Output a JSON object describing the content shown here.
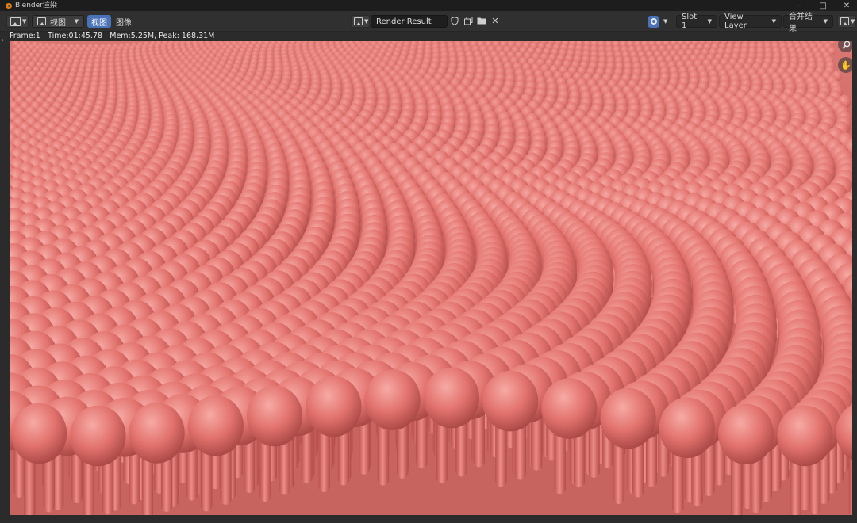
{
  "window": {
    "title": "Blender渲染",
    "minimize": "–",
    "maximize": "□",
    "close": "✕"
  },
  "header": {
    "menu_view": "视图",
    "tab_view": "视图",
    "menu_image": "图像",
    "image_name": "Render Result",
    "slot": "Slot 1",
    "view_layer": "View Layer",
    "pass": "合并结果"
  },
  "render_info": "Frame:1 | Time:01:45.78 | Mem:5.25M, Peak: 168.31M",
  "render": {
    "subject": "rows of pink lipid-bilayer-like shapes",
    "base_color": "#e2726d",
    "highlight_color": "#f5a19c",
    "shadow_color": "#9e4342",
    "background_color": "#3b3b3b"
  },
  "icons": {
    "editor_type": "image-editor-icon",
    "display_mode": "image-display-icon",
    "fake_user": "shield-icon",
    "new_image": "duplicate-icon",
    "open": "folder-icon",
    "unlink": "close-icon",
    "render_slot": "render-slot-icon",
    "display_channels": "channels-icon",
    "zoom": "zoom-icon",
    "pan": "hand-icon"
  }
}
